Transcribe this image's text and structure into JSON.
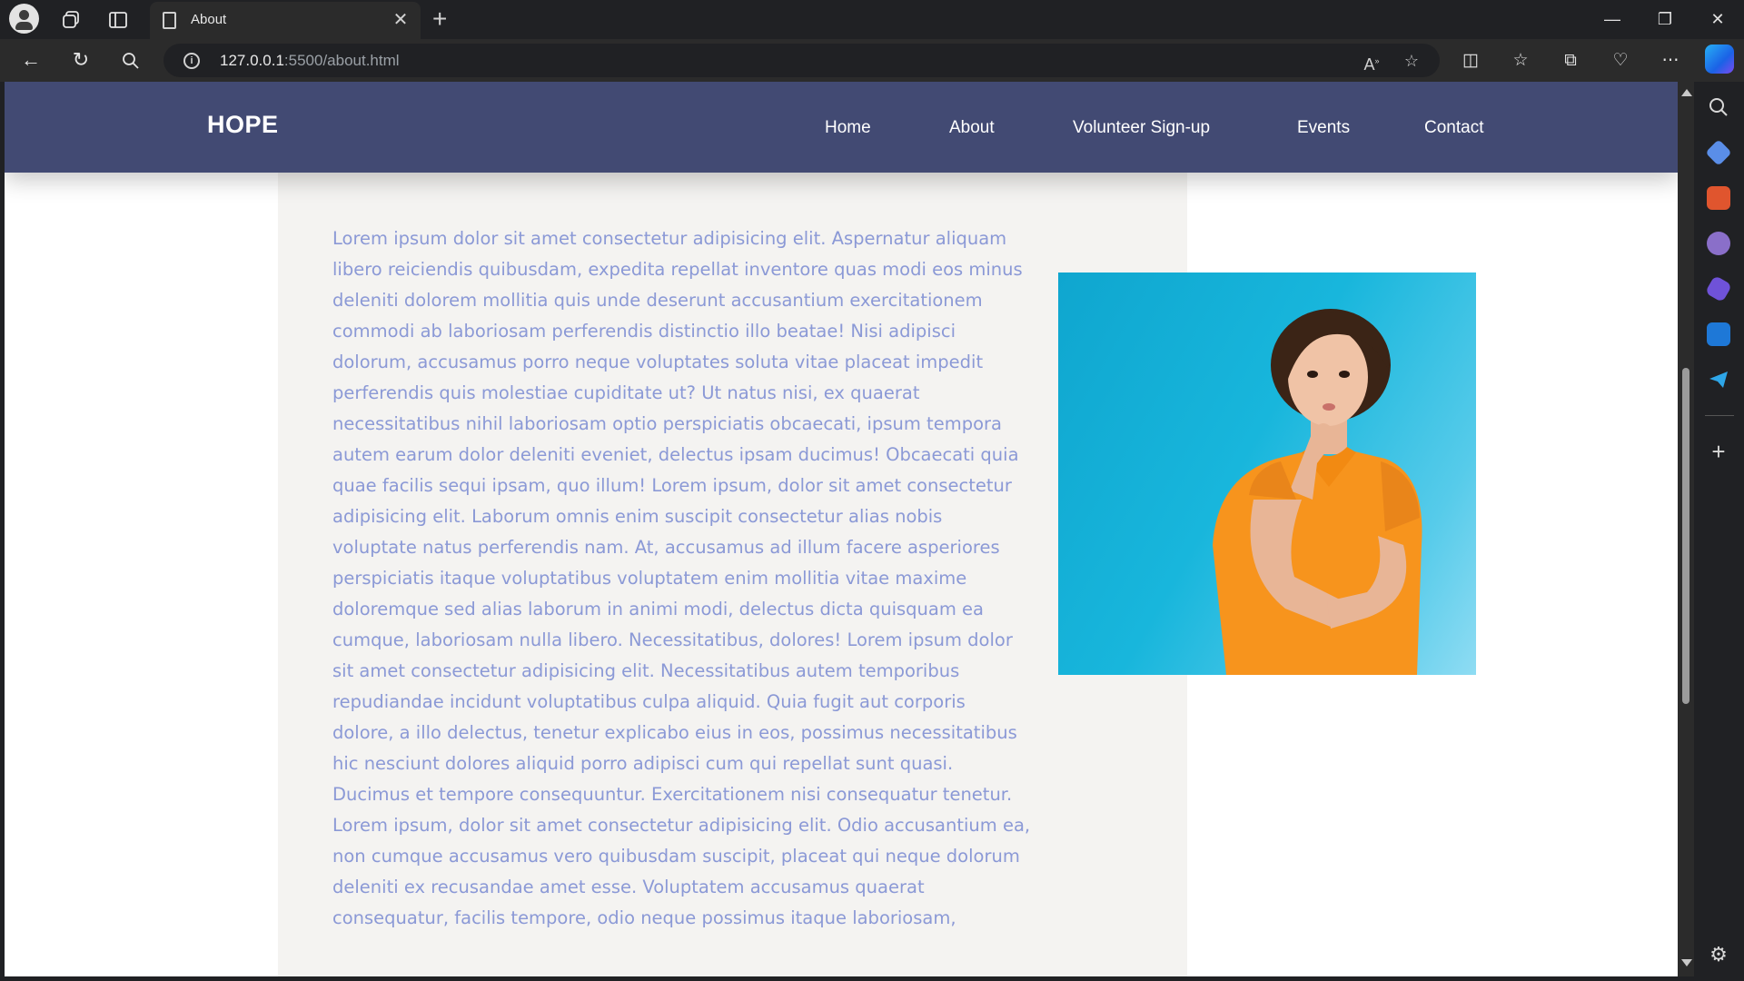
{
  "browser": {
    "tab_title": "About",
    "url_host": "127.0.0.1",
    "url_rest": ":5500/about.html"
  },
  "site": {
    "logo": "HOPE",
    "nav": [
      "Home",
      "About",
      "Volunteer Sign-up",
      "Events",
      "Contact"
    ],
    "body_text": "Lorem ipsum dolor sit amet consectetur adipisicing elit. Aspernatur aliquam libero reiciendis quibusdam, expedita repellat inventore quas modi eos minus deleniti dolorem mollitia quis unde deserunt accusantium exercitationem commodi ab laboriosam perferendis distinctio illo beatae! Nisi adipisci dolorum, accusamus porro neque voluptates soluta vitae placeat impedit perferendis quis molestiae cupiditate ut? Ut natus nisi, ex quaerat necessitatibus nihil laboriosam optio perspiciatis obcaecati, ipsum tempora autem earum dolor deleniti eveniet, delectus ipsam ducimus! Obcaecati quia quae facilis sequi ipsam, quo illum! Lorem ipsum, dolor sit amet consectetur adipisicing elit. Laborum omnis enim suscipit consectetur alias nobis voluptate natus perferendis nam. At, accusamus ad illum facere asperiores perspiciatis itaque voluptatibus voluptatem enim mollitia vitae maxime doloremque sed alias laborum in animi modi, delectus dicta quisquam ea cumque, laboriosam nulla libero. Necessitatibus, dolores! Lorem ipsum dolor sit amet consectetur adipisicing elit. Necessitatibus autem temporibus repudiandae incidunt voluptatibus culpa aliquid. Quia fugit aut corporis dolore, a illo delectus, tenetur explicabo eius in eos, possimus necessitatibus hic nesciunt dolores aliquid porro adipisci cum qui repellat sunt quasi. Ducimus et tempore consequuntur. Exercitationem nisi consequatur tenetur. Lorem ipsum, dolor sit amet consectetur adipisicing elit. Odio accusantium ea, non cumque accusamus vero quibusdam suscipit, placeat qui neque dolorum deleniti ex recusandae amet esse. Voluptatem accusamus quaerat consequatur, facilis tempore, odio neque possimus itaque laboriosam,"
  },
  "colors": {
    "header_bg": "#424a73",
    "body_text": "#8b99d6",
    "panel_bg": "#f4f3f1",
    "photo_bg": "#18b6dc",
    "shirt": "#f7941d"
  }
}
